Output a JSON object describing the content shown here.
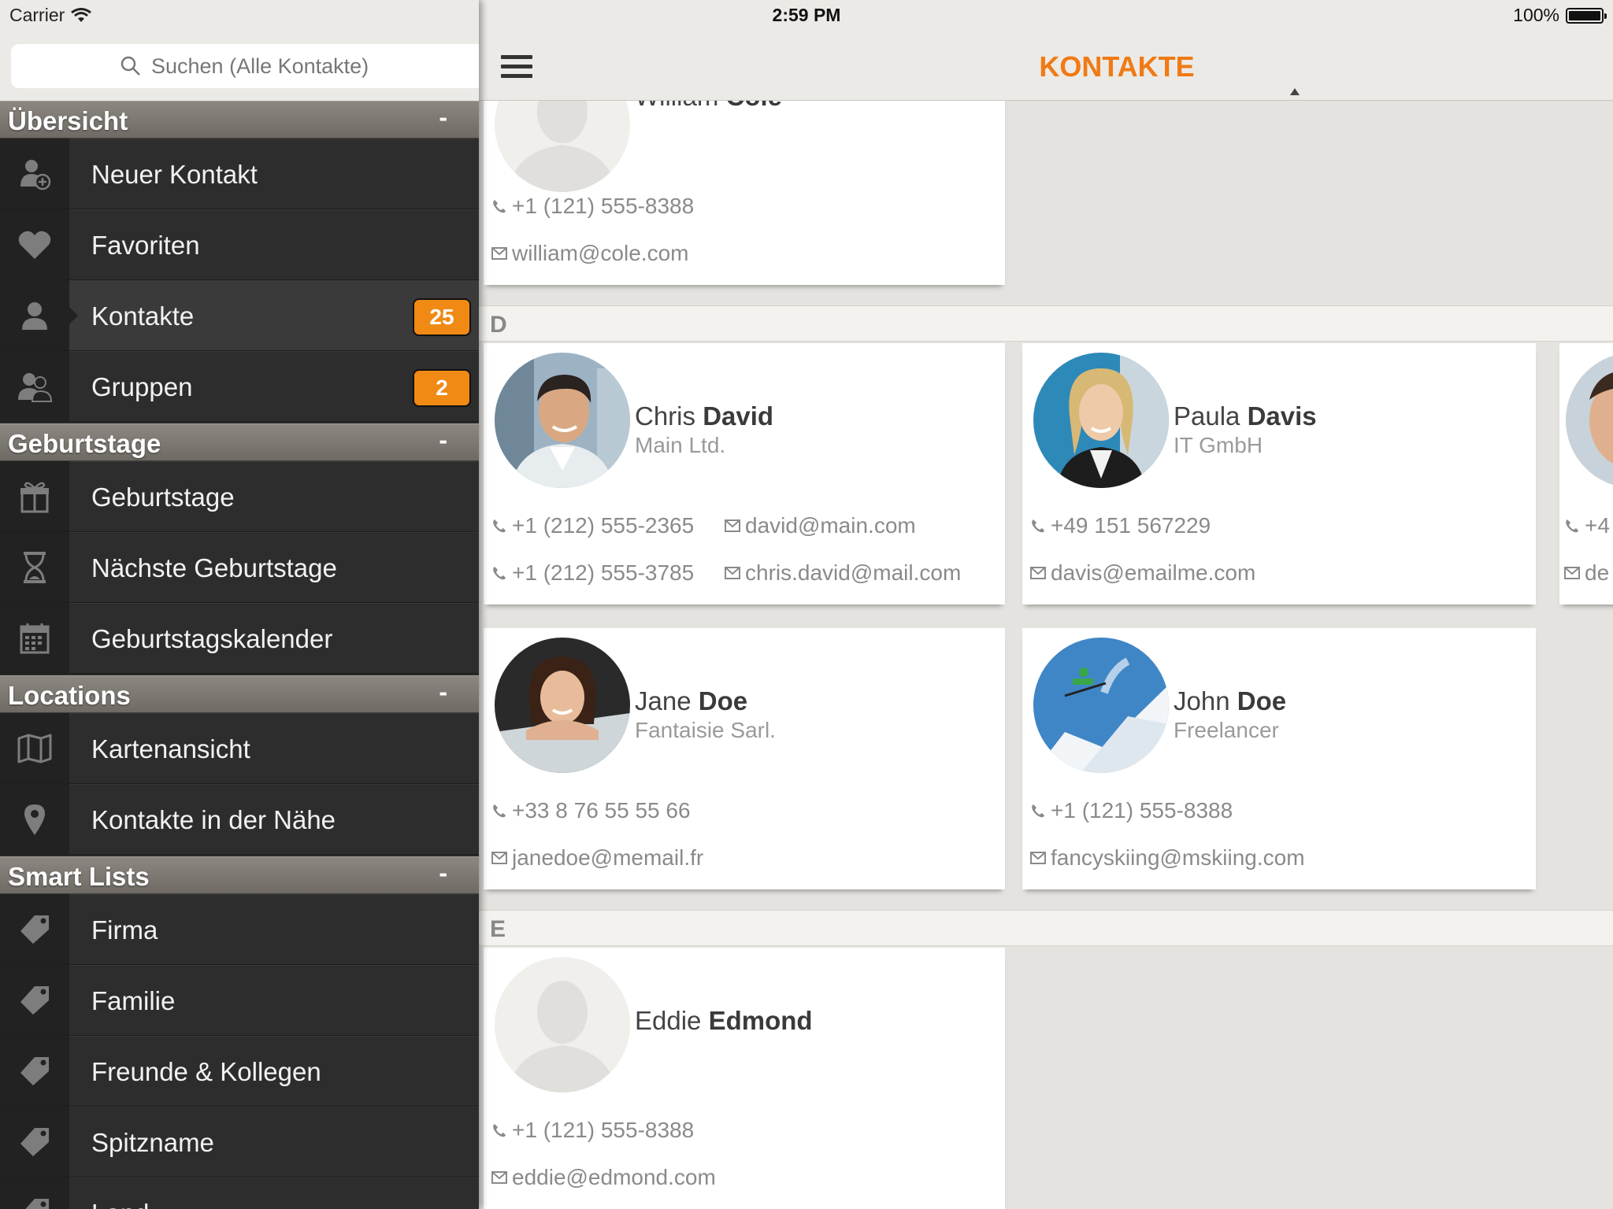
{
  "status": {
    "carrier": "Carrier",
    "time": "2:59 PM",
    "battery": "100%"
  },
  "search": {
    "placeholder": "Suchen (Alle Kontakte)"
  },
  "sidebar": {
    "sections": [
      {
        "title": "Übersicht",
        "collapse": "-",
        "items": [
          {
            "label": "Neuer Kontakt",
            "icon": "add-person-icon"
          },
          {
            "label": "Favoriten",
            "icon": "heart-icon"
          },
          {
            "label": "Kontakte",
            "icon": "person-icon",
            "badge": "25",
            "active": true
          },
          {
            "label": "Gruppen",
            "icon": "group-icon",
            "badge": "2"
          }
        ]
      },
      {
        "title": "Geburtstage",
        "collapse": "-",
        "items": [
          {
            "label": "Geburtstage",
            "icon": "gift-icon"
          },
          {
            "label": "Nächste Geburtstage",
            "icon": "hourglass-icon"
          },
          {
            "label": "Geburtstagskalender",
            "icon": "calendar-icon"
          }
        ]
      },
      {
        "title": "Locations",
        "collapse": "-",
        "items": [
          {
            "label": "Kartenansicht",
            "icon": "map-icon"
          },
          {
            "label": "Kontakte in der Nähe",
            "icon": "pin-icon"
          }
        ]
      },
      {
        "title": "Smart Lists",
        "collapse": "-",
        "items": [
          {
            "label": "Firma",
            "icon": "tag-icon"
          },
          {
            "label": "Familie",
            "icon": "tag-icon"
          },
          {
            "label": "Freunde & Kollegen",
            "icon": "tag-icon"
          },
          {
            "label": "Spitzname",
            "icon": "tag-icon"
          },
          {
            "label": "Land",
            "icon": "tag-icon"
          }
        ]
      }
    ]
  },
  "navbar": {
    "title": "KONTAKTE"
  },
  "sections": [
    {
      "letter": "D"
    },
    {
      "letter": "E"
    }
  ],
  "contacts": {
    "william": {
      "first": "William",
      "last": "Cole",
      "phone": "+1 (121) 555-8388",
      "email": "william@cole.com"
    },
    "chris": {
      "first": "Chris",
      "last": "David",
      "company": "Main Ltd.",
      "phone1": "+1 (212) 555-2365",
      "phone2": "+1 (212) 555-3785",
      "email1": "david@main.com",
      "email2": "chris.david@mail.com"
    },
    "paula": {
      "first": "Paula",
      "last": "Davis",
      "company": "IT GmbH",
      "phone": "+49 151 567229",
      "email": "davis@emailme.com"
    },
    "partial": {
      "phone": "+4",
      "email": "de"
    },
    "jane": {
      "first": "Jane",
      "last": "Doe",
      "company": "Fantaisie Sarl.",
      "phone": "+33 8 76 55 55 66",
      "email": "janedoe@memail.fr"
    },
    "john": {
      "first": "John",
      "last": "Doe",
      "company": "Freelancer",
      "phone": "+1 (121) 555-8388",
      "email": "fancyskiing@mskiing.com"
    },
    "eddie": {
      "first": "Eddie",
      "last": "Edmond",
      "phone": "+1 (121) 555-8388",
      "email": "eddie@edmond.com"
    }
  },
  "colors": {
    "accent": "#f07a14",
    "badge": "#f08a14",
    "sidebar": "#2a2a2a"
  }
}
